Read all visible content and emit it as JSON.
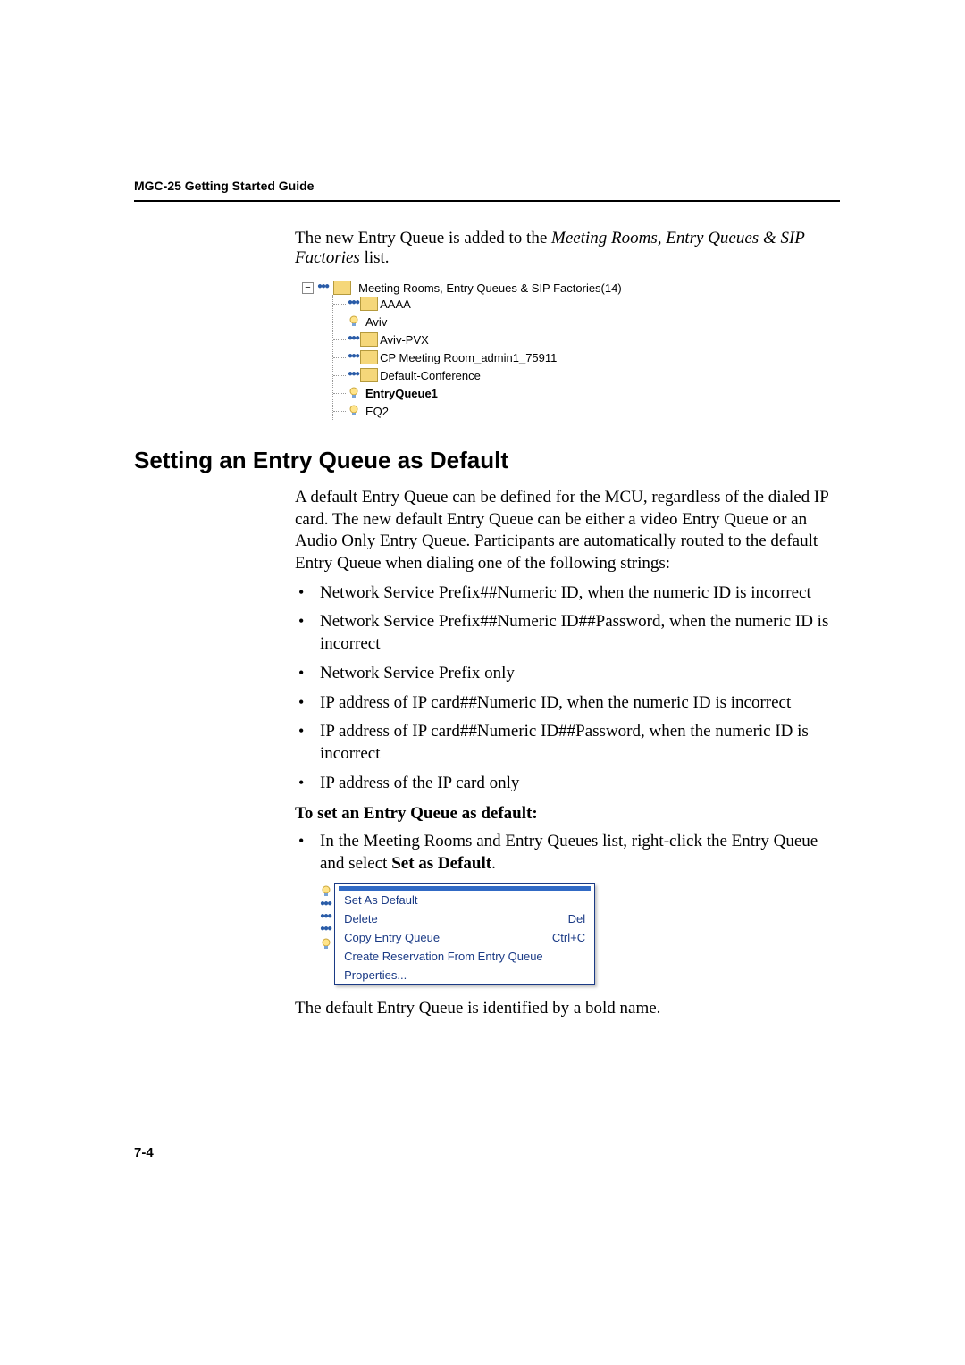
{
  "header": {
    "guide_title": "MGC-25 Getting Started Guide"
  },
  "intro_line_1": "The new Entry Queue is added to the ",
  "intro_italic": "Meeting Rooms, Entry Queues & SIP Factories",
  "intro_line_2": " list.",
  "tree": {
    "root": "Meeting Rooms, Entry Queues & SIP Factories(14)",
    "items": [
      {
        "label": "AAAA",
        "icon": "folder",
        "bold": false
      },
      {
        "label": "Aviv",
        "icon": "lamp",
        "bold": false
      },
      {
        "label": "Aviv-PVX",
        "icon": "folder",
        "bold": false
      },
      {
        "label": "CP Meeting Room_admin1_75911",
        "icon": "folder",
        "bold": false
      },
      {
        "label": "Default-Conference",
        "icon": "folder",
        "bold": false
      },
      {
        "label": "EntryQueue1",
        "icon": "lamp",
        "bold": true
      },
      {
        "label": "EQ2",
        "icon": "lamp",
        "bold": false
      }
    ]
  },
  "section_heading": "Setting an Entry Queue as Default",
  "para1": "A default Entry Queue can be defined for the MCU, regardless of the dialed IP card. The new default Entry Queue can be either a video Entry Queue or an Audio Only Entry Queue. Participants are automatically routed to the default Entry Queue when dialing one of the following strings:",
  "bullets": [
    "Network Service Prefix##Numeric ID, when the numeric ID is incorrect",
    "Network Service Prefix##Numeric ID##Password, when the numeric ID is incorrect",
    "Network Service Prefix only",
    "IP address of IP card##Numeric ID, when the numeric ID is incorrect",
    "IP address of IP card##Numeric ID##Password, when the numeric ID is incorrect",
    "IP address of the IP card only"
  ],
  "subhead": "To set an Entry Queue as default:",
  "step_bullet_pre": "In the Meeting Rooms and Entry Queues list, right-click the Entry Queue and select ",
  "step_bullet_bold": "Set as Default",
  "step_bullet_post": ".",
  "context_menu": {
    "items": [
      {
        "label": "Set As Default",
        "shortcut": ""
      },
      {
        "label": "Delete",
        "shortcut": "Del"
      },
      {
        "label": "Copy Entry Queue",
        "shortcut": "Ctrl+C"
      },
      {
        "label": "Create Reservation From Entry Queue",
        "shortcut": ""
      },
      {
        "label": "Properties...",
        "shortcut": ""
      }
    ]
  },
  "closing": "The default Entry Queue is identified by a bold name.",
  "page_number": "7-4"
}
